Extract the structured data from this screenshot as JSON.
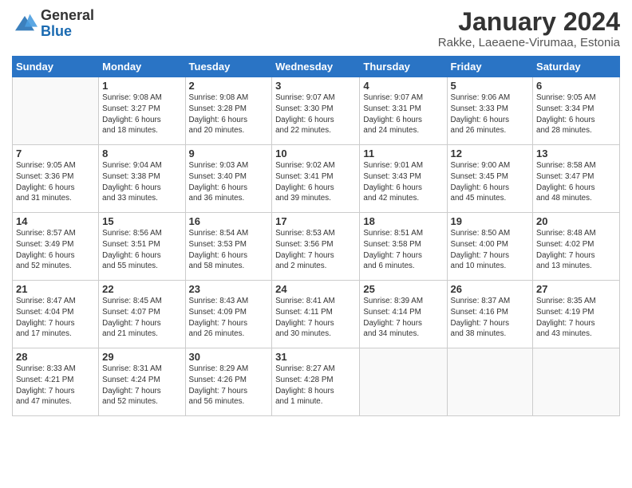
{
  "logo": {
    "general": "General",
    "blue": "Blue"
  },
  "header": {
    "title": "January 2024",
    "subtitle": "Rakke, Laeaene-Virumaa, Estonia"
  },
  "weekdays": [
    "Sunday",
    "Monday",
    "Tuesday",
    "Wednesday",
    "Thursday",
    "Friday",
    "Saturday"
  ],
  "weeks": [
    [
      {
        "day": "",
        "info": ""
      },
      {
        "day": "1",
        "info": "Sunrise: 9:08 AM\nSunset: 3:27 PM\nDaylight: 6 hours\nand 18 minutes."
      },
      {
        "day": "2",
        "info": "Sunrise: 9:08 AM\nSunset: 3:28 PM\nDaylight: 6 hours\nand 20 minutes."
      },
      {
        "day": "3",
        "info": "Sunrise: 9:07 AM\nSunset: 3:30 PM\nDaylight: 6 hours\nand 22 minutes."
      },
      {
        "day": "4",
        "info": "Sunrise: 9:07 AM\nSunset: 3:31 PM\nDaylight: 6 hours\nand 24 minutes."
      },
      {
        "day": "5",
        "info": "Sunrise: 9:06 AM\nSunset: 3:33 PM\nDaylight: 6 hours\nand 26 minutes."
      },
      {
        "day": "6",
        "info": "Sunrise: 9:05 AM\nSunset: 3:34 PM\nDaylight: 6 hours\nand 28 minutes."
      }
    ],
    [
      {
        "day": "7",
        "info": "Sunrise: 9:05 AM\nSunset: 3:36 PM\nDaylight: 6 hours\nand 31 minutes."
      },
      {
        "day": "8",
        "info": "Sunrise: 9:04 AM\nSunset: 3:38 PM\nDaylight: 6 hours\nand 33 minutes."
      },
      {
        "day": "9",
        "info": "Sunrise: 9:03 AM\nSunset: 3:40 PM\nDaylight: 6 hours\nand 36 minutes."
      },
      {
        "day": "10",
        "info": "Sunrise: 9:02 AM\nSunset: 3:41 PM\nDaylight: 6 hours\nand 39 minutes."
      },
      {
        "day": "11",
        "info": "Sunrise: 9:01 AM\nSunset: 3:43 PM\nDaylight: 6 hours\nand 42 minutes."
      },
      {
        "day": "12",
        "info": "Sunrise: 9:00 AM\nSunset: 3:45 PM\nDaylight: 6 hours\nand 45 minutes."
      },
      {
        "day": "13",
        "info": "Sunrise: 8:58 AM\nSunset: 3:47 PM\nDaylight: 6 hours\nand 48 minutes."
      }
    ],
    [
      {
        "day": "14",
        "info": "Sunrise: 8:57 AM\nSunset: 3:49 PM\nDaylight: 6 hours\nand 52 minutes."
      },
      {
        "day": "15",
        "info": "Sunrise: 8:56 AM\nSunset: 3:51 PM\nDaylight: 6 hours\nand 55 minutes."
      },
      {
        "day": "16",
        "info": "Sunrise: 8:54 AM\nSunset: 3:53 PM\nDaylight: 6 hours\nand 58 minutes."
      },
      {
        "day": "17",
        "info": "Sunrise: 8:53 AM\nSunset: 3:56 PM\nDaylight: 7 hours\nand 2 minutes."
      },
      {
        "day": "18",
        "info": "Sunrise: 8:51 AM\nSunset: 3:58 PM\nDaylight: 7 hours\nand 6 minutes."
      },
      {
        "day": "19",
        "info": "Sunrise: 8:50 AM\nSunset: 4:00 PM\nDaylight: 7 hours\nand 10 minutes."
      },
      {
        "day": "20",
        "info": "Sunrise: 8:48 AM\nSunset: 4:02 PM\nDaylight: 7 hours\nand 13 minutes."
      }
    ],
    [
      {
        "day": "21",
        "info": "Sunrise: 8:47 AM\nSunset: 4:04 PM\nDaylight: 7 hours\nand 17 minutes."
      },
      {
        "day": "22",
        "info": "Sunrise: 8:45 AM\nSunset: 4:07 PM\nDaylight: 7 hours\nand 21 minutes."
      },
      {
        "day": "23",
        "info": "Sunrise: 8:43 AM\nSunset: 4:09 PM\nDaylight: 7 hours\nand 26 minutes."
      },
      {
        "day": "24",
        "info": "Sunrise: 8:41 AM\nSunset: 4:11 PM\nDaylight: 7 hours\nand 30 minutes."
      },
      {
        "day": "25",
        "info": "Sunrise: 8:39 AM\nSunset: 4:14 PM\nDaylight: 7 hours\nand 34 minutes."
      },
      {
        "day": "26",
        "info": "Sunrise: 8:37 AM\nSunset: 4:16 PM\nDaylight: 7 hours\nand 38 minutes."
      },
      {
        "day": "27",
        "info": "Sunrise: 8:35 AM\nSunset: 4:19 PM\nDaylight: 7 hours\nand 43 minutes."
      }
    ],
    [
      {
        "day": "28",
        "info": "Sunrise: 8:33 AM\nSunset: 4:21 PM\nDaylight: 7 hours\nand 47 minutes."
      },
      {
        "day": "29",
        "info": "Sunrise: 8:31 AM\nSunset: 4:24 PM\nDaylight: 7 hours\nand 52 minutes."
      },
      {
        "day": "30",
        "info": "Sunrise: 8:29 AM\nSunset: 4:26 PM\nDaylight: 7 hours\nand 56 minutes."
      },
      {
        "day": "31",
        "info": "Sunrise: 8:27 AM\nSunset: 4:28 PM\nDaylight: 8 hours\nand 1 minute."
      },
      {
        "day": "",
        "info": ""
      },
      {
        "day": "",
        "info": ""
      },
      {
        "day": "",
        "info": ""
      }
    ]
  ]
}
